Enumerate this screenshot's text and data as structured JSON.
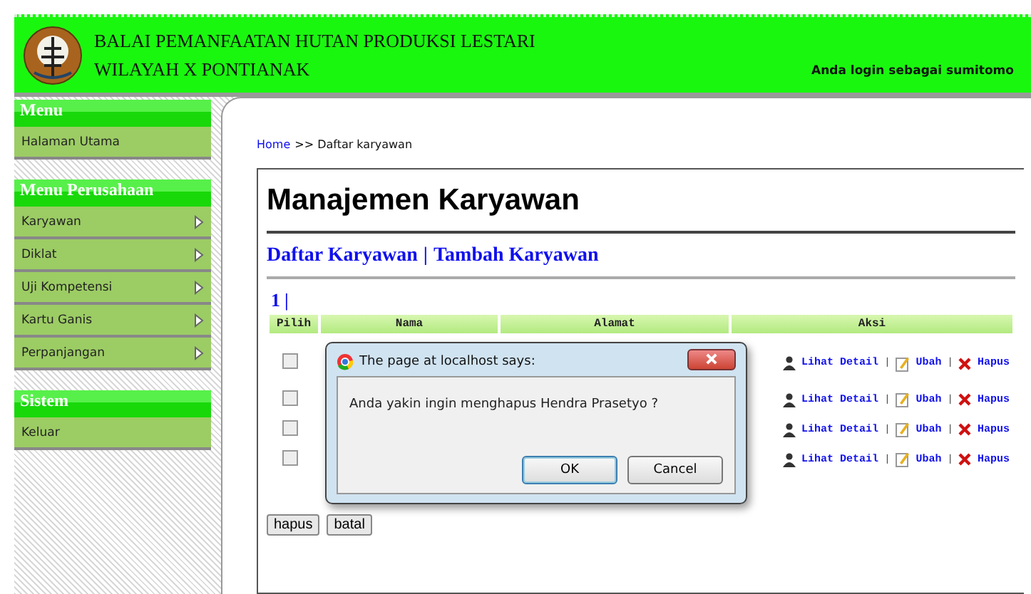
{
  "header": {
    "title_line1": "BALAI PEMANFAATAN HUTAN PRODUKSI LESTARI",
    "title_line2": "WILAYAH X PONTIANAK",
    "login_text": "Anda login sebagai sumitomo"
  },
  "sidebar": [
    {
      "heading": "Menu",
      "items": [
        {
          "label": "Halaman Utama",
          "arrow": false
        }
      ]
    },
    {
      "heading": "Menu Perusahaan",
      "items": [
        {
          "label": "Karyawan",
          "arrow": true
        },
        {
          "label": "Diklat",
          "arrow": true
        },
        {
          "label": "Uji Kompetensi",
          "arrow": true
        },
        {
          "label": "Kartu Ganis",
          "arrow": true
        },
        {
          "label": "Perpanjangan",
          "arrow": true
        }
      ]
    },
    {
      "heading": "Sistem",
      "items": [
        {
          "label": "Keluar",
          "arrow": false
        }
      ]
    }
  ],
  "breadcrumb": {
    "link": "Home",
    "rest": ">> Daftar karyawan"
  },
  "page_title": "Manajemen Karyawan",
  "subnav": {
    "links": [
      "Daftar Karyawan",
      "Tambah Karyawan"
    ],
    "separator": "|"
  },
  "pagination": {
    "pages": [
      "1"
    ],
    "separator": "|"
  },
  "table": {
    "columns": [
      "Pilih",
      "Nama",
      "Alamat",
      "Aksi"
    ],
    "rows": [
      {
        "checked": false,
        "actions": [
          "Lihat Detail",
          "Ubah",
          "Hapus"
        ],
        "separators": [
          "|",
          "|"
        ]
      },
      {
        "checked": false,
        "actions": [
          "Lihat Detail",
          "Ubah",
          "Hapus"
        ],
        "separators": [
          "|",
          "|"
        ]
      },
      {
        "checked": false,
        "actions": [
          "Lihat Detail",
          "Ubah",
          "Hapus"
        ],
        "separators": [
          "|",
          "|"
        ]
      },
      {
        "checked": false,
        "actions": [
          "Lihat Detail",
          "Ubah",
          "Hapus"
        ],
        "separators": [
          "|",
          "|"
        ]
      }
    ]
  },
  "form_buttons": [
    "hapus",
    "batal"
  ],
  "dialog": {
    "title": "The page at localhost says:",
    "message": "Anda yakin ingin menghapus Hendra Prasetyo ?",
    "buttons": [
      {
        "label": "OK",
        "selected": true
      },
      {
        "label": "Cancel",
        "selected": false
      }
    ]
  }
}
